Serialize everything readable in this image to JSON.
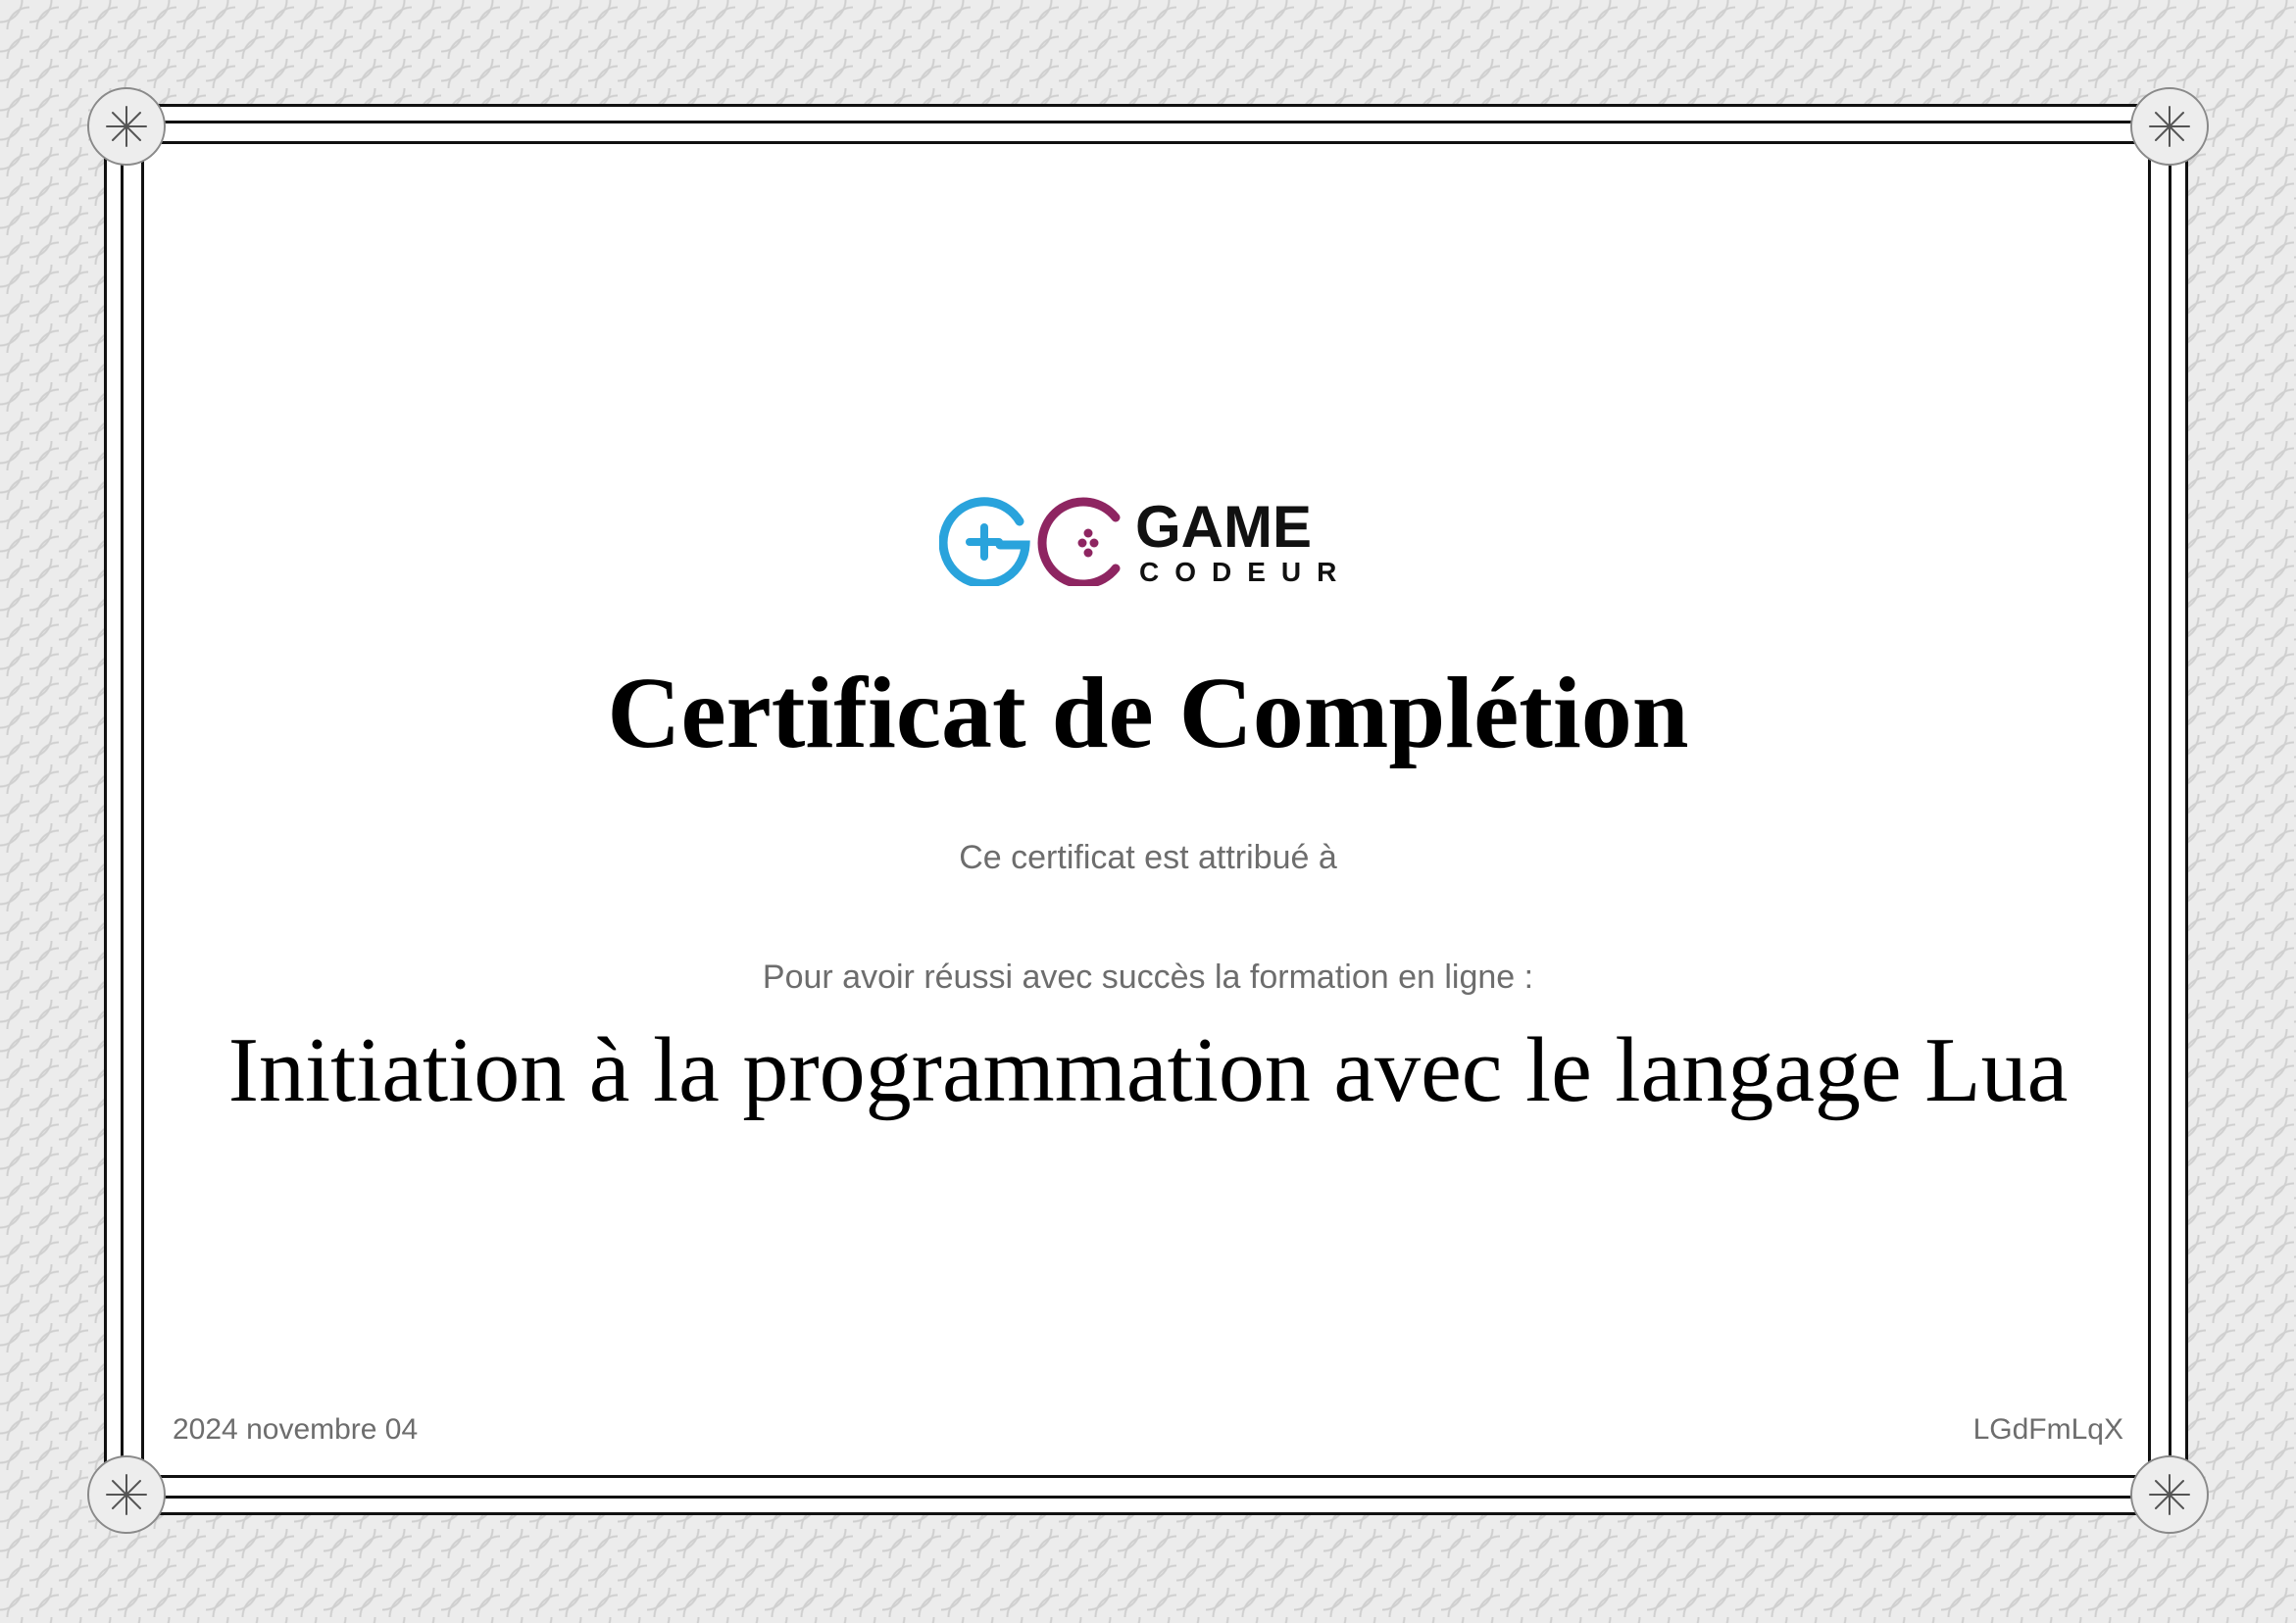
{
  "certificate": {
    "logo": {
      "brand_main": "GAME",
      "brand_sub": "CODEUR",
      "primary_color": "#29a3dc",
      "secondary_color": "#8e2561"
    },
    "title": "Certificat de Complétion",
    "awarded_to": "Ce certificat est attribué à",
    "completion_text": "Pour avoir réussi avec succès la formation en ligne :",
    "course_name": "Initiation à la programmation avec le langage Lua",
    "date": "2024 novembre 04",
    "certificate_code": "LGdFmLqX"
  }
}
